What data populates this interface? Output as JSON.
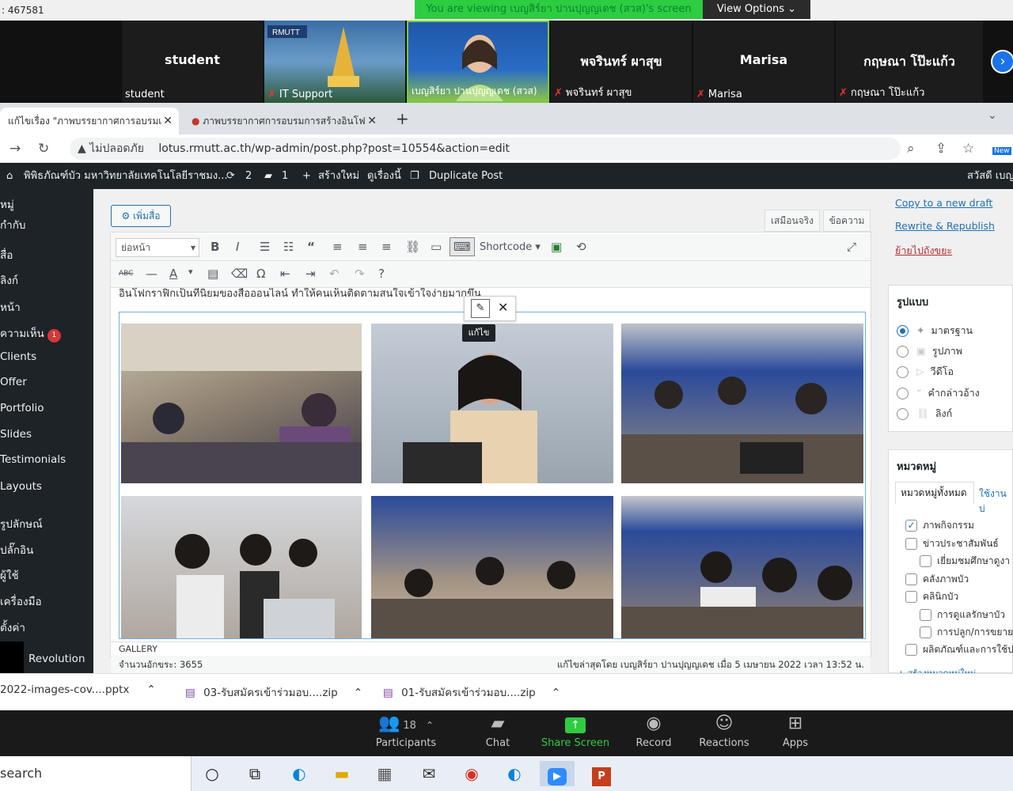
{
  "zoom": {
    "meeting_id": ": 467581",
    "viewing_banner": "You are viewing เบญสิร์ยา ปานปุญญเดช (สวส)'s screen",
    "view_options": "View Options ⌄",
    "participants": [
      {
        "big": "student",
        "label": "student"
      },
      {
        "big": "",
        "label": "IT Support"
      },
      {
        "big": "",
        "label": "เบญสิร์ยา ปานปุญญเดช (สวส)"
      },
      {
        "big": "พจรินทร์ ผาสุข",
        "label": "พจรินทร์ ผาสุข"
      },
      {
        "big": "Marisa",
        "label": "Marisa"
      },
      {
        "big": "กฤษณา โป๊ะแก้ว",
        "label": "กฤษณา โป๊ะแก้ว"
      }
    ],
    "bottom": {
      "participants_count": "18",
      "participants": "Participants",
      "chat": "Chat",
      "share": "Share Screen",
      "record": "Record",
      "reactions": "Reactions",
      "apps": "Apps"
    },
    "colors": {
      "share": "#2ecc40",
      "banner": "#2ecc40"
    }
  },
  "browser": {
    "tab1": "แก้ไขเรื่อง \"ภาพบรรยากาศการอบรมเ",
    "tab2": "ภาพบรรยากาศการอบรมการสร้างอินโฟ",
    "not_secure": "ไม่ปลอดภัย",
    "url": "lotus.rmutt.ac.th/wp-admin/post.php?post=10554&action=edit",
    "new_badge": "New"
  },
  "wpbar": {
    "site": "พิพิธภัณฑ์บัว มหาวิทยาลัยเทคโนโลยีราชมง...",
    "updates": "2",
    "comments": "1",
    "new": "สร้างใหม่",
    "view": "ดูเรื่องนี้",
    "duplicate": "Duplicate Post",
    "greeting": "สวัสดี เบญ"
  },
  "sidebar": [
    "หมู่",
    "กำกับ",
    "สื่อ",
    "ลิงก์",
    "หน้า",
    "ความเห็น",
    "Clients",
    "Offer",
    "Portfolio",
    "Slides",
    "Testimonials",
    "Layouts",
    "รูปลักษณ์",
    "ปลั๊กอิน",
    "ผู้ใช้",
    "เครื่องมือ",
    "ตั้งค่า",
    "Revolution"
  ],
  "sidebar_comment_badge": "1",
  "editor": {
    "add_media": "เพิ่มสื่อ",
    "tab_visual": "เสมือนจริง",
    "tab_text": "ข้อความ",
    "format": "ย่อหน้า",
    "shortcode": "Shortcode ▾",
    "cut_text": "อินโฟกราฟิกเป็นทีนิยมของสื่อออนไลน์ ทำให้คนเห็นติดตามสนใจเข้าใจง่ายมากขึ้น",
    "tooltip": "แก้ไข",
    "gallery_label": "GALLERY",
    "word_count": "จำนวนอักขระ: 3655",
    "last_edit": "แก้ไขล่าสุดโดย เบญสิร์ยา ปานปุญญเดช เมื่อ 5 เมษายน 2022 เวลา 13:52 น."
  },
  "right": {
    "copy_draft": "Copy to a new draft",
    "rewrite": "Rewrite & Republish",
    "trash": "ย้ายไปถังขยะ",
    "format_title": "รูปแบบ",
    "formats": [
      "มาตรฐาน",
      "รูปภาพ",
      "วีดีโอ",
      "คำกล่าวอ้าง",
      "ลิงก์"
    ],
    "cat_title": "หมวดหมู่",
    "cat_tab_all": "หมวดหมู่ทั้งหมด",
    "cat_tab_used": "ใช้งานบ่",
    "cats": [
      "ภาพกิจกรรม",
      "ข่าวประชาสัมพันธ์",
      "เยี่ยมชมศึกษาดูงา",
      "คลังภาพบัว",
      "คลินิกบัว",
      "การดูแลรักษาบัว",
      "การปลูก/การขยาย",
      "ผลิตภัณฑ์และการใช้ป"
    ],
    "add_cat": "+ สร้างหมวดหมู่ใหม่"
  },
  "downloads": [
    "2022-images-cov....pptx",
    "03-รับสมัครเข้าร่วมอบ....zip",
    "01-รับสมัครเข้าร่วมอบ....zip"
  ],
  "taskbar": {
    "search": "search"
  }
}
